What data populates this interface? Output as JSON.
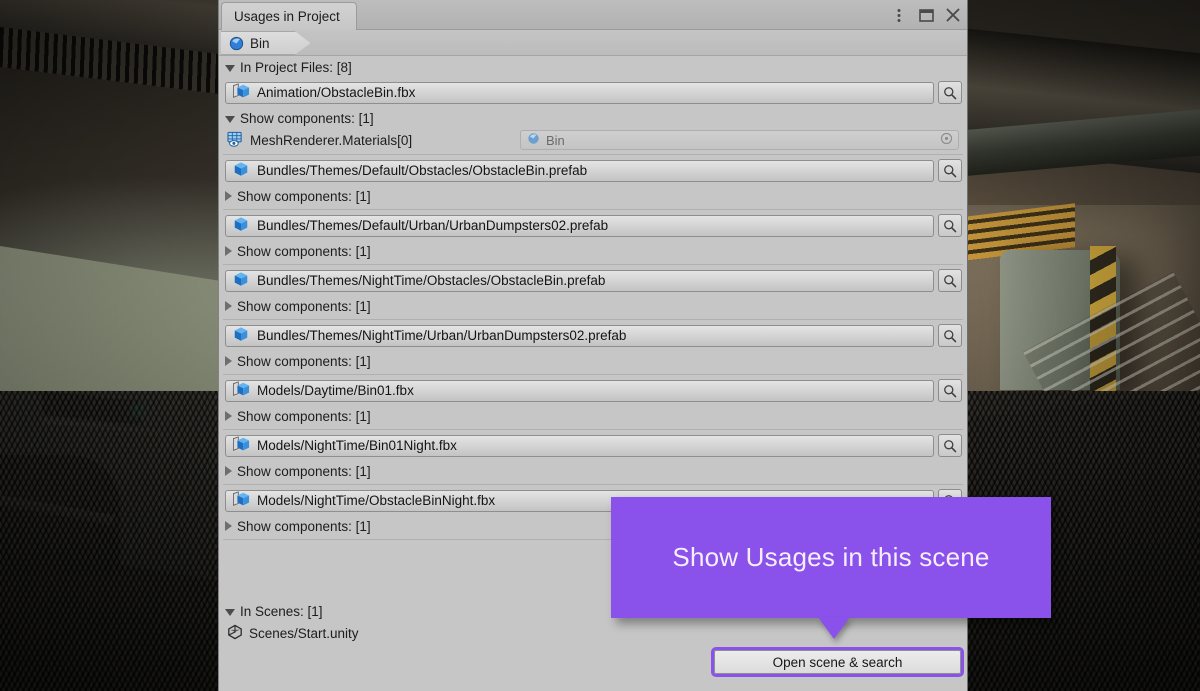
{
  "window": {
    "tab_label": "Usages in Project",
    "controls": [
      {
        "name": "kebab-menu-icon",
        "label": "⋮"
      },
      {
        "name": "maximize-icon",
        "label": "☐"
      },
      {
        "name": "close-icon",
        "label": "✕"
      }
    ]
  },
  "breadcrumb": {
    "label": "Bin",
    "icon": "material-sphere-icon"
  },
  "sections": {
    "project": {
      "label": "In Project Files: [8]",
      "expanded": true,
      "count": 8
    },
    "scenes": {
      "label": "In Scenes: [1]",
      "expanded": true,
      "count": 1,
      "items": [
        {
          "label": "Scenes/Start.unity",
          "icon": "unity-scene-icon"
        }
      ]
    }
  },
  "files": [
    {
      "path": "Animation/ObstacleBin.fbx",
      "icon": "fbx-model-icon",
      "components_label": "Show components: [1]",
      "expanded": true,
      "components": [
        {
          "label": "MeshRenderer.Materials[0]",
          "icon": "mesh-renderer-icon",
          "value": "Bin",
          "value_icon": "material-sphere-icon"
        }
      ]
    },
    {
      "path": "Bundles/Themes/Default/Obstacles/ObstacleBin.prefab",
      "icon": "prefab-icon",
      "components_label": "Show components: [1]",
      "expanded": false,
      "components": []
    },
    {
      "path": "Bundles/Themes/Default/Urban/UrbanDumpsters02.prefab",
      "icon": "prefab-icon",
      "components_label": "Show components: [1]",
      "expanded": false,
      "components": []
    },
    {
      "path": "Bundles/Themes/NightTime/Obstacles/ObstacleBin.prefab",
      "icon": "prefab-icon",
      "components_label": "Show components: [1]",
      "expanded": false,
      "components": []
    },
    {
      "path": "Bundles/Themes/NightTime/Urban/UrbanDumpsters02.prefab",
      "icon": "prefab-icon",
      "components_label": "Show components: [1]",
      "expanded": false,
      "components": []
    },
    {
      "path": "Models/Daytime/Bin01.fbx",
      "icon": "fbx-model-icon",
      "components_label": "Show components: [1]",
      "expanded": false,
      "components": []
    },
    {
      "path": "Models/NightTime/Bin01Night.fbx",
      "icon": "fbx-model-icon",
      "components_label": "Show components: [1]",
      "expanded": false,
      "components": []
    },
    {
      "path": "Models/NightTime/ObstacleBinNight.fbx",
      "icon": "fbx-model-icon",
      "components_label": "Show components: [1]",
      "expanded": false,
      "components": []
    }
  ],
  "footer": {
    "open_scene_button": "Open scene & search"
  },
  "callout": {
    "text": "Show Usages in this scene",
    "color": "#8a52ea",
    "text_color": "#f4eefd"
  },
  "colors": {
    "panel_bg": "#c6c6c6",
    "field_bg": "#d8d8d8",
    "accent_purple": "#8a52ea",
    "prefab_blue": "#2a7fd4"
  }
}
